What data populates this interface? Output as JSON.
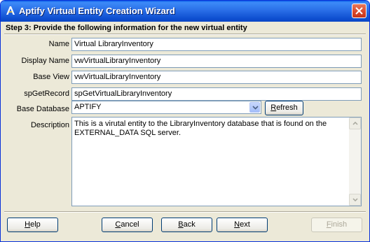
{
  "window": {
    "title": "Aptify Virtual Entity Creation Wizard"
  },
  "step": {
    "title": "Step 3: Provide the following information for the new virtual entity"
  },
  "form": {
    "name": {
      "label": "Name",
      "value": "Virtual LibraryInventory"
    },
    "display_name": {
      "label": "Display Name",
      "value": "vwVirtualLibraryInventory"
    },
    "base_view": {
      "label": "Base View",
      "value": "vwVirtualLibraryInventory"
    },
    "sp_get_record": {
      "label": "spGetRecord",
      "value": "spGetVirtualLibraryInventory"
    },
    "base_database": {
      "label": "Base Database",
      "value": "APTIFY",
      "refresh_label_pre": "",
      "refresh_label_key": "R",
      "refresh_label_post": "efresh"
    },
    "description": {
      "label": "Description",
      "value": "This is a virutal entity to the LibraryInventory database that is found on the EXTERNAL_DATA SQL server."
    }
  },
  "footer": {
    "help": {
      "key": "H",
      "rest": "elp"
    },
    "cancel": {
      "key": "C",
      "rest": "ancel"
    },
    "back": {
      "key": "B",
      "rest": "ack"
    },
    "next": {
      "key": "N",
      "rest": "ext"
    },
    "finish": {
      "key": "F",
      "rest": "inish",
      "enabled": false
    }
  },
  "colors": {
    "titlebar": "#0a5ee8",
    "dialog_bg": "#ece9d8",
    "input_border": "#7f9db9",
    "button_border": "#003c74"
  },
  "icons": {
    "app": "aptify-logo-icon",
    "close": "close-icon",
    "combo": "chevron-down-icon",
    "scroll_up": "scroll-up-arrow-icon",
    "scroll_down": "scroll-down-arrow-icon"
  }
}
